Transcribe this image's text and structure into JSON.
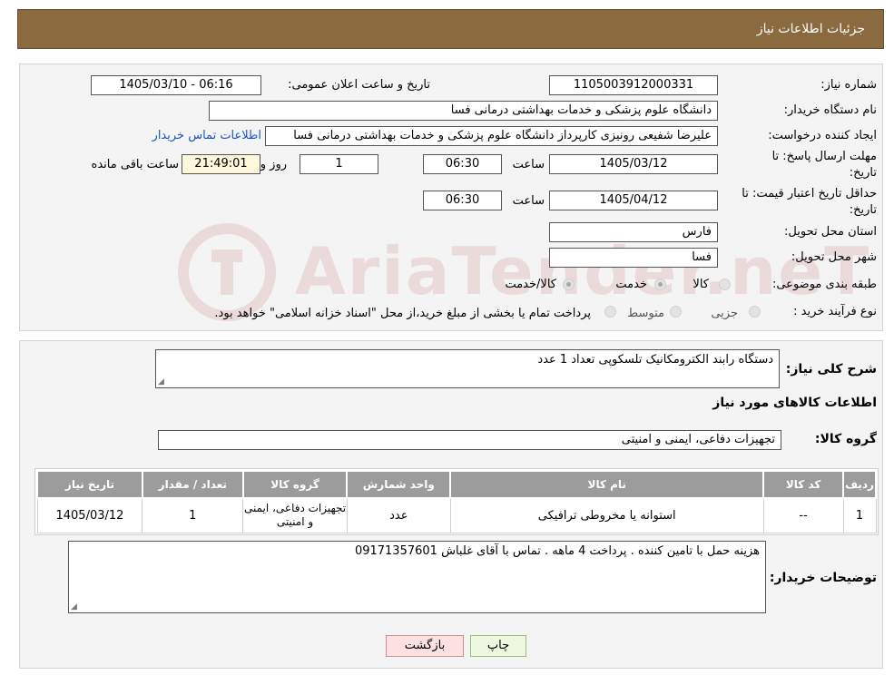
{
  "header": {
    "title": "جزئیات اطلاعات نیاز"
  },
  "form": {
    "need_number_label": "شماره نیاز:",
    "need_number": "1105003912000331",
    "announce_label": "تاریخ و ساعت اعلان عمومی:",
    "announce_value": "1405/03/10 - 06:16",
    "buyer_org_label": "نام دستگاه خریدار:",
    "buyer_org": "دانشگاه علوم پزشکی و خدمات بهداشتی درمانی فسا",
    "creator_label": "ایجاد کننده درخواست:",
    "creator": "علیرضا شفیعی رونیزی کارپرداز دانشگاه علوم پزشکی و خدمات بهداشتی درمانی فسا",
    "buyer_contact_link": "اطلاعات تماس خریدار",
    "deadline_label_1": "مهلت ارسال پاسخ: تا",
    "deadline_label_2": "تاریخ:",
    "deadline_date": "1405/03/12",
    "time_label": "ساعت",
    "deadline_time": "06:30",
    "days_remaining": "1",
    "days_label": "روز و",
    "time_remaining": "21:49:01",
    "remaining_label": "ساعت باقی مانده",
    "validity_label_1": "حداقل تاریخ اعتبار قیمت: تا",
    "validity_label_2": "تاریخ:",
    "validity_date": "1405/04/12",
    "validity_time": "06:30",
    "province_label": "استان محل تحویل:",
    "province": "فارس",
    "city_label": "شهر محل تحویل:",
    "city": "فسا",
    "category_label": "طبقه بندی موضوعی:",
    "category_options": [
      "کالا",
      "خدمت",
      "کالا/خدمت"
    ],
    "purchase_type_label": "نوع فرآیند خرید :",
    "purchase_options": [
      "جزیی",
      "متوسط"
    ],
    "purchase_note": "پرداخت تمام یا بخشی از مبلغ خرید،از محل \"اسناد خزانه اسلامی\" خواهد بود."
  },
  "watermark": {
    "text": "AriaTender.neT"
  },
  "details": {
    "description_label": "شرح کلی نیاز:",
    "description": "دستگاه رابند الکترومکانیک تلسکوپی تعداد  1 عدد",
    "goods_info_title": "اطلاعات کالاهای مورد نیاز",
    "goods_group_label": "گروه کالا:",
    "goods_group": "تجهیزات دفاعی، ایمنی و امنیتی"
  },
  "table": {
    "headers": [
      "ردیف",
      "کد کالا",
      "نام کالا",
      "واحد شمارش",
      "گروه کالا",
      "تعداد / مقدار",
      "تاریخ نیاز"
    ],
    "rows": [
      [
        "1",
        "--",
        "استوانه یا مخروطی ترافیکی",
        "عدد",
        "تجهیزات دفاعی، ایمنی و امنیتی",
        "1",
        "1405/03/12"
      ]
    ]
  },
  "buyer_notes": {
    "label": "توضیحات خریدار:",
    "text": "هزینه حمل با تامین کننده . پرداخت 4 ماهه . تماس با آقای غلباش 09171357601"
  },
  "buttons": {
    "back": "بازگشت",
    "print": "چاپ"
  }
}
